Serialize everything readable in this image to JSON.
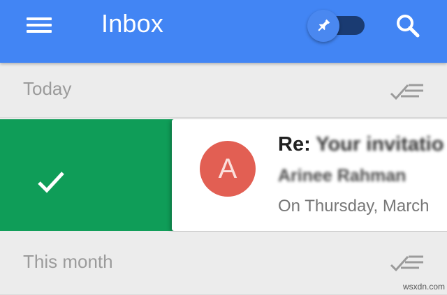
{
  "appbar": {
    "title": "Inbox",
    "icons": [
      "menu-icon",
      "pin-icon",
      "search-icon"
    ]
  },
  "sections": [
    {
      "label": "Today",
      "icon": "done-all-icon"
    },
    {
      "label": "This month",
      "icon": "done-all-icon"
    }
  ],
  "email": {
    "avatar_letter": "A",
    "subject_prefix": "Re:",
    "subject": "Your invitatio",
    "sender": "Arinee Rahman",
    "snippet": "On Thursday, March",
    "swipe_action": "check-icon"
  },
  "colors": {
    "appbar": "#4285f4",
    "swipe_done": "#0f9d58",
    "avatar": "#e25f53",
    "background": "#ececec"
  },
  "watermark": "wsxdn.com"
}
